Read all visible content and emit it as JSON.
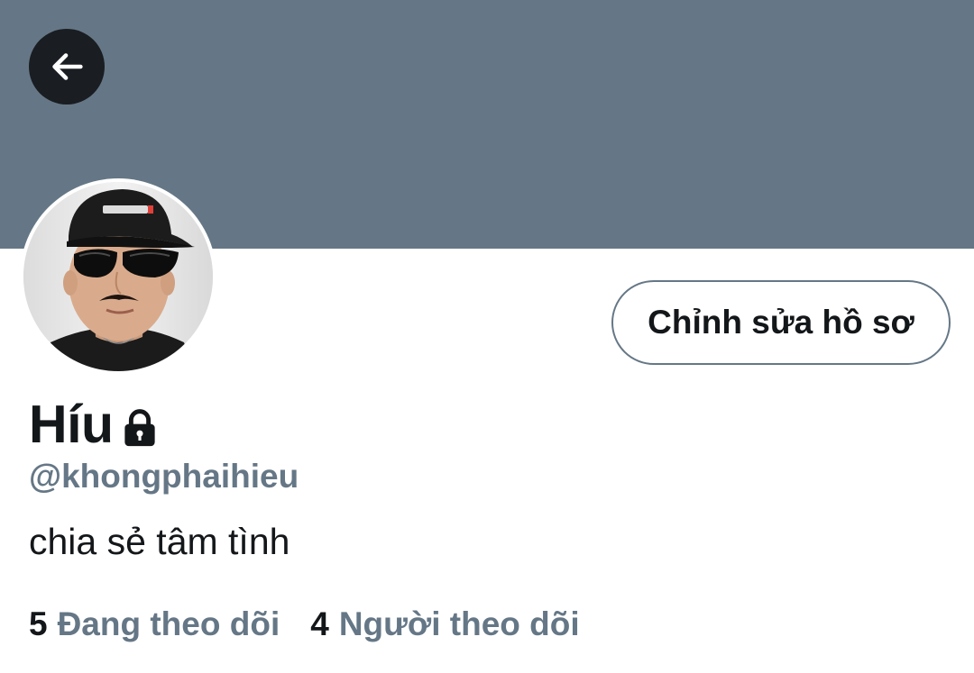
{
  "colors": {
    "banner": "#657786",
    "text_primary": "#14171a",
    "text_secondary": "#657786",
    "back_button_bg": "#1a1d21"
  },
  "header": {
    "back_icon": "arrow-left-icon"
  },
  "profile": {
    "edit_button_label": "Chỉnh sửa hồ sơ",
    "display_name": "Híu",
    "protected_icon": "lock-icon",
    "handle": "@khongphaihieu",
    "bio": "chia sẻ tâm tình",
    "stats": {
      "following_count": "5",
      "following_label": "Đang theo dõi",
      "followers_count": "4",
      "followers_label": "Người theo dõi"
    }
  }
}
